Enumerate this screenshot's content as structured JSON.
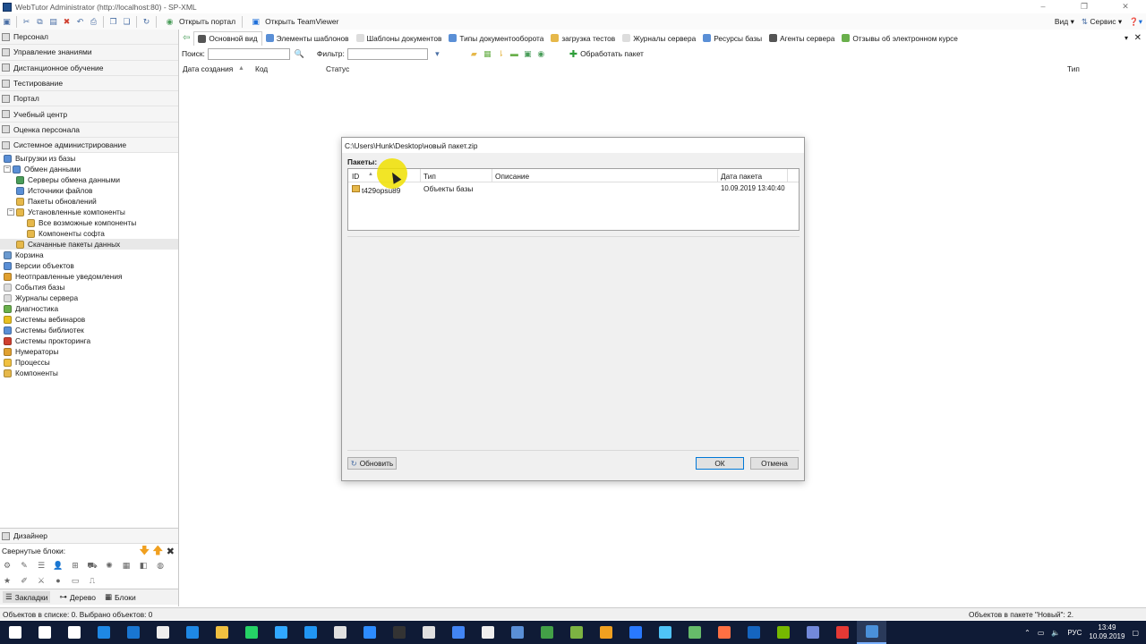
{
  "window": {
    "title": "WebTutor Administrator (http://localhost:80) - SP-XML",
    "controls": [
      "–",
      "❐",
      "✕"
    ]
  },
  "toolbar": {
    "open_portal": "Открыть портал",
    "open_teamviewer": "Открыть TeamViewer",
    "view": "Вид",
    "service": "Сервис"
  },
  "sidebar": {
    "sections": [
      "Персонал",
      "Управление знаниями",
      "Дистанционное обучение",
      "Тестирование",
      "Портал",
      "Учебный центр",
      "Оценка персонала",
      "Системное администрирование"
    ],
    "tree": [
      {
        "label": "Выгрузки из базы",
        "level": 1,
        "color": "#5a8fd6"
      },
      {
        "label": "Обмен данными",
        "level": 1,
        "color": "#5a8fd6",
        "expander": "−"
      },
      {
        "label": "Серверы обмена данными",
        "level": 2,
        "color": "#4a9d5a"
      },
      {
        "label": "Источники файлов",
        "level": 2,
        "color": "#5a8fd6"
      },
      {
        "label": "Пакеты обновлений",
        "level": 2,
        "color": "#e6b84a"
      },
      {
        "label": "Установленные компоненты",
        "level": 2,
        "color": "#e6b84a",
        "expander": "−"
      },
      {
        "label": "Все возможные компоненты",
        "level": 3,
        "color": "#e6b84a"
      },
      {
        "label": "Компоненты софта",
        "level": 3,
        "color": "#e6b84a"
      },
      {
        "label": "Скачанные пакеты данных",
        "level": 2,
        "color": "#e6b84a",
        "selected": true
      },
      {
        "label": "Корзина",
        "level": 1,
        "color": "#6a9ad0"
      },
      {
        "label": "Версии объектов",
        "level": 1,
        "color": "#5a8fd6"
      },
      {
        "label": "Неотправленные уведомления",
        "level": 1,
        "color": "#e0a030"
      },
      {
        "label": "События базы",
        "level": 1,
        "color": "#dddddd"
      },
      {
        "label": "Журналы сервера",
        "level": 1,
        "color": "#dddddd"
      },
      {
        "label": "Диагностика",
        "level": 1,
        "color": "#6ab04c"
      },
      {
        "label": "Системы вебинаров",
        "level": 1,
        "color": "#e8c020"
      },
      {
        "label": "Системы библиотек",
        "level": 1,
        "color": "#5a8fd6"
      },
      {
        "label": "Системы прокторинга",
        "level": 1,
        "color": "#d04030"
      },
      {
        "label": "Нумераторы",
        "level": 1,
        "color": "#e0a030"
      },
      {
        "label": "Процессы",
        "level": 1,
        "color": "#f0c040"
      },
      {
        "label": "Компоненты",
        "level": 1,
        "color": "#e6b84a"
      }
    ],
    "designer": "Дизайнер",
    "collapsed_blocks": "Свернутые блоки:",
    "bottom_tabs": [
      "Закладки",
      "Дерево",
      "Блоки"
    ]
  },
  "tabs": [
    {
      "label": "Основной вид",
      "color": "#555555",
      "active": true
    },
    {
      "label": "Элементы шаблонов",
      "color": "#5a8fd6"
    },
    {
      "label": "Шаблоны документов",
      "color": "#dddddd"
    },
    {
      "label": "Типы документооборота",
      "color": "#5a8fd6"
    },
    {
      "label": "загрузка тестов",
      "color": "#e6b84a"
    },
    {
      "label": "Журналы сервера",
      "color": "#dddddd"
    },
    {
      "label": "Ресурсы базы",
      "color": "#5a8fd6"
    },
    {
      "label": "Агенты сервера",
      "color": "#555555"
    },
    {
      "label": "Отзывы об электронном курсе",
      "color": "#6ab04c"
    }
  ],
  "filterbar": {
    "search_label": "Поиск:",
    "filter_label": "Фильтр:",
    "process_package": "Обработать пакет"
  },
  "columns": [
    "Дата создания",
    "Код",
    "Статус",
    "Тип"
  ],
  "dialog": {
    "title": "C:\\Users\\Hunk\\Desktop\\новый пакет.zip",
    "packages_label": "Пакеты:",
    "grid_headers": [
      "ID",
      "Тип",
      "Описание",
      "Дата пакета"
    ],
    "rows": [
      {
        "id": "t429opsu89",
        "type": "Объекты базы",
        "description": "",
        "date": "10.09.2019 13:40:40"
      }
    ],
    "refresh": "Обновить",
    "ok": "ОК",
    "cancel": "Отмена"
  },
  "statusbar": {
    "left": "Объектов в списке: 0. Выбрано объектов: 0",
    "right": "Объектов в пакете \"Новый\": 2."
  },
  "taskbar": {
    "apps": [
      "#ffffff",
      "#ffffff",
      "#ffffff",
      "#1e88e5",
      "#1976d2",
      "#eeeeee",
      "#1e88e5",
      "#f0c040",
      "#25d366",
      "#31a8ff",
      "#2196f3",
      "#e0e0e0",
      "#2d8cff",
      "#333333",
      "#e0e0e0",
      "#4285f4",
      "#eeeeee",
      "#5a8fd6",
      "#43a047",
      "#7cb342",
      "#f0a020",
      "#2979ff",
      "#4fc3f7",
      "#66bb6a",
      "#ff7043",
      "#1565c0",
      "#76b900",
      "#7289da",
      "#e53935",
      "#4a90d9"
    ],
    "language": "РУС",
    "time": "13:49",
    "date": "10.09.2019"
  }
}
